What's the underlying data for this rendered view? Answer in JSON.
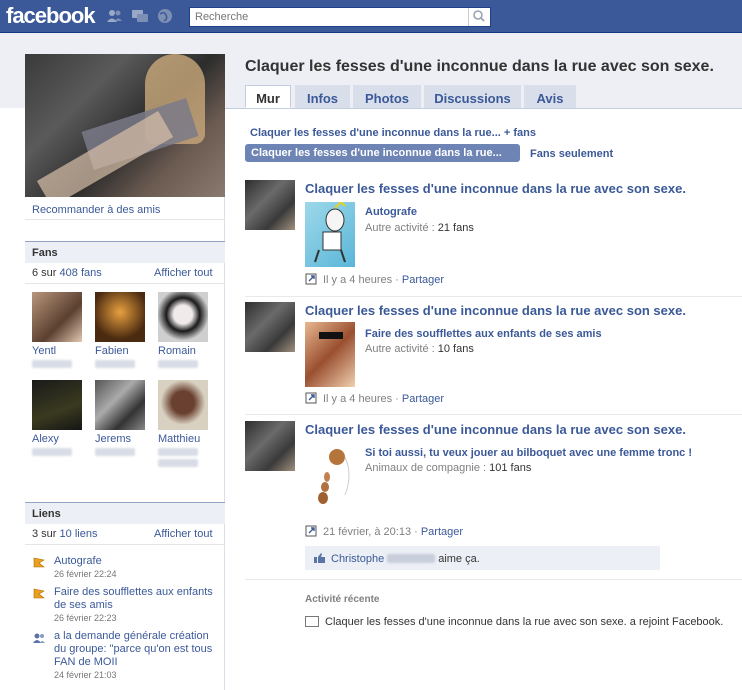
{
  "topbar": {
    "logo": "facebook",
    "search_placeholder": "Recherche",
    "icons": [
      "friends-icon",
      "messages-icon",
      "notifications-globe-icon",
      "search-icon"
    ]
  },
  "profile": {
    "recommend_link": "Recommander à des amis"
  },
  "page": {
    "title": "Claquer les fesses d'une inconnue dans la rue avec son sexe."
  },
  "tabs": [
    {
      "label": "Mur",
      "active": true
    },
    {
      "label": "Infos"
    },
    {
      "label": "Photos"
    },
    {
      "label": "Discussions"
    },
    {
      "label": "Avis"
    }
  ],
  "wall_filters": {
    "all": "Claquer les fesses d'une inconnue dans la rue... + fans",
    "page_only": "Claquer les fesses d'une inconnue dans la rue...",
    "fans_only": "Fans seulement"
  },
  "fans_box": {
    "title": "Fans",
    "count_prefix": "6 sur",
    "count_link": "408 fans",
    "show_all": "Afficher tout",
    "fans": [
      {
        "name": "Yentl"
      },
      {
        "name": "Fabien"
      },
      {
        "name": "Romain"
      },
      {
        "name": "Alexy"
      },
      {
        "name": "Jerems"
      },
      {
        "name": "Matthieu"
      }
    ]
  },
  "links_box": {
    "title": "Liens",
    "count_prefix": "3 sur",
    "count_link": "10 liens",
    "show_all": "Afficher tout",
    "items": [
      {
        "title": "Autografe",
        "date": "26 février 22:24"
      },
      {
        "title": "Faire des soufflettes aux enfants de ses amis",
        "date": "26 février 22:23"
      },
      {
        "title": "a la demande générale création du groupe: \"parce qu'on est tous FAN de MOII",
        "date": "24 février 21:03"
      }
    ]
  },
  "stories": [
    {
      "author": "Claquer les fesses d'une inconnue dans la rue avec son sexe.",
      "attachment_title": "Autografe",
      "attachment_label": "Autre activité :",
      "attachment_value": "21 fans",
      "time": "Il y a 4 heures",
      "share": "Partager"
    },
    {
      "author": "Claquer les fesses d'une inconnue dans la rue avec son sexe.",
      "attachment_title": "Faire des soufflettes aux enfants de ses amis",
      "attachment_label": "Autre activité :",
      "attachment_value": "10 fans",
      "time": "Il y a 4 heures",
      "share": "Partager"
    },
    {
      "author": "Claquer les fesses d'une inconnue dans la rue avec son sexe.",
      "attachment_title": "Si toi aussi, tu veux jouer au bilboquet avec une femme tronc !",
      "attachment_label": "Animaux de compagnie :",
      "attachment_value": "101 fans",
      "time": "21 février, à 20:13",
      "share": "Partager",
      "like_name": "Christophe",
      "like_text": "aime ça."
    }
  ],
  "recent_activity": {
    "title": "Activité récente",
    "item": "Claquer les fesses d'une inconnue dans la rue avec son sexe. a rejoint Facebook."
  },
  "colors": {
    "brand": "#3b5998",
    "header_band": "#edeff4",
    "filter_selected": "#6d84b4"
  }
}
